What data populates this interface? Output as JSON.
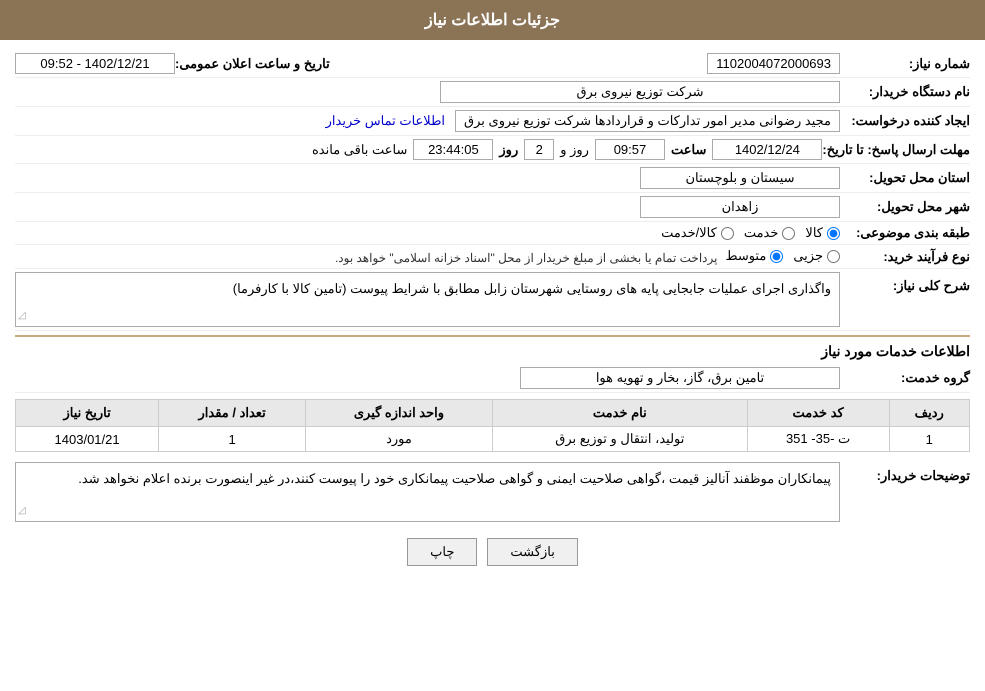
{
  "header": {
    "title": "جزئیات اطلاعات نیاز"
  },
  "fields": {
    "request_number_label": "شماره نیاز:",
    "request_number_value": "1102004072000693",
    "buyer_org_label": "نام دستگاه خریدار:",
    "buyer_org_value": "شرکت توزیع نیروی برق",
    "creator_label": "ایجاد کننده درخواست:",
    "creator_value": "مجید  رضوانی مدیر امور تدارکات و قراردادها شرکت توزیع نیروی برق",
    "contact_link": "اطلاعات تماس خریدار",
    "announce_date_label": "تاریخ و ساعت اعلان عمومی:",
    "announce_date_value": "1402/12/21 - 09:52",
    "response_deadline_label": "مهلت ارسال پاسخ: تا تاریخ:",
    "response_date": "1402/12/24",
    "response_time": "09:57",
    "response_days": "2",
    "response_time_remaining": "23:44:05",
    "remaining_label_day": "روز و",
    "remaining_label_hour": "ساعت باقی مانده",
    "province_label": "استان محل تحویل:",
    "province_value": "سیستان و بلوچستان",
    "city_label": "شهر محل تحویل:",
    "city_value": "زاهدان",
    "category_label": "طبقه بندی موضوعی:",
    "category_options": [
      "کالا",
      "خدمت",
      "کالا/خدمت"
    ],
    "category_selected": "کالا",
    "purchase_type_label": "نوع فرآیند خرید:",
    "purchase_type_options": [
      "جزیی",
      "متوسط"
    ],
    "purchase_type_selected": "متوسط",
    "purchase_type_note": "پرداخت تمام یا بخشی از مبلغ خریدار از محل \"اسناد خزانه اسلامی\" خواهد بود.",
    "description_label": "شرح کلی نیاز:",
    "description_value": "واگذاری اجرای عملیات جابجایی پایه های روستایی شهرستان زابل مطابق با شرایط پیوست (تامین کالا با کارفرما)",
    "services_section_title": "اطلاعات خدمات مورد نیاز",
    "service_group_label": "گروه خدمت:",
    "service_group_value": "تامین برق، گاز، بخار و تهویه هوا",
    "table": {
      "headers": [
        "ردیف",
        "کد خدمت",
        "نام خدمت",
        "واحد اندازه گیری",
        "تعداد / مقدار",
        "تاریخ نیاز"
      ],
      "rows": [
        {
          "row_num": "1",
          "service_code": "ت -35- 351",
          "service_name": "تولید، انتقال و توزیع برق",
          "unit": "مورد",
          "quantity": "1",
          "date": "1403/01/21"
        }
      ]
    },
    "buyer_notes_label": "توضیحات خریدار:",
    "buyer_notes_value": "پیمانکاران موظفند آنالیز قیمت ،گواهی صلاحیت ایمنی و گواهی صلاحیت پیمانکاری خود را پیوست کنند،در غیر اینصورت برنده اعلام نخواهد شد."
  },
  "buttons": {
    "print": "چاپ",
    "back": "بازگشت"
  }
}
